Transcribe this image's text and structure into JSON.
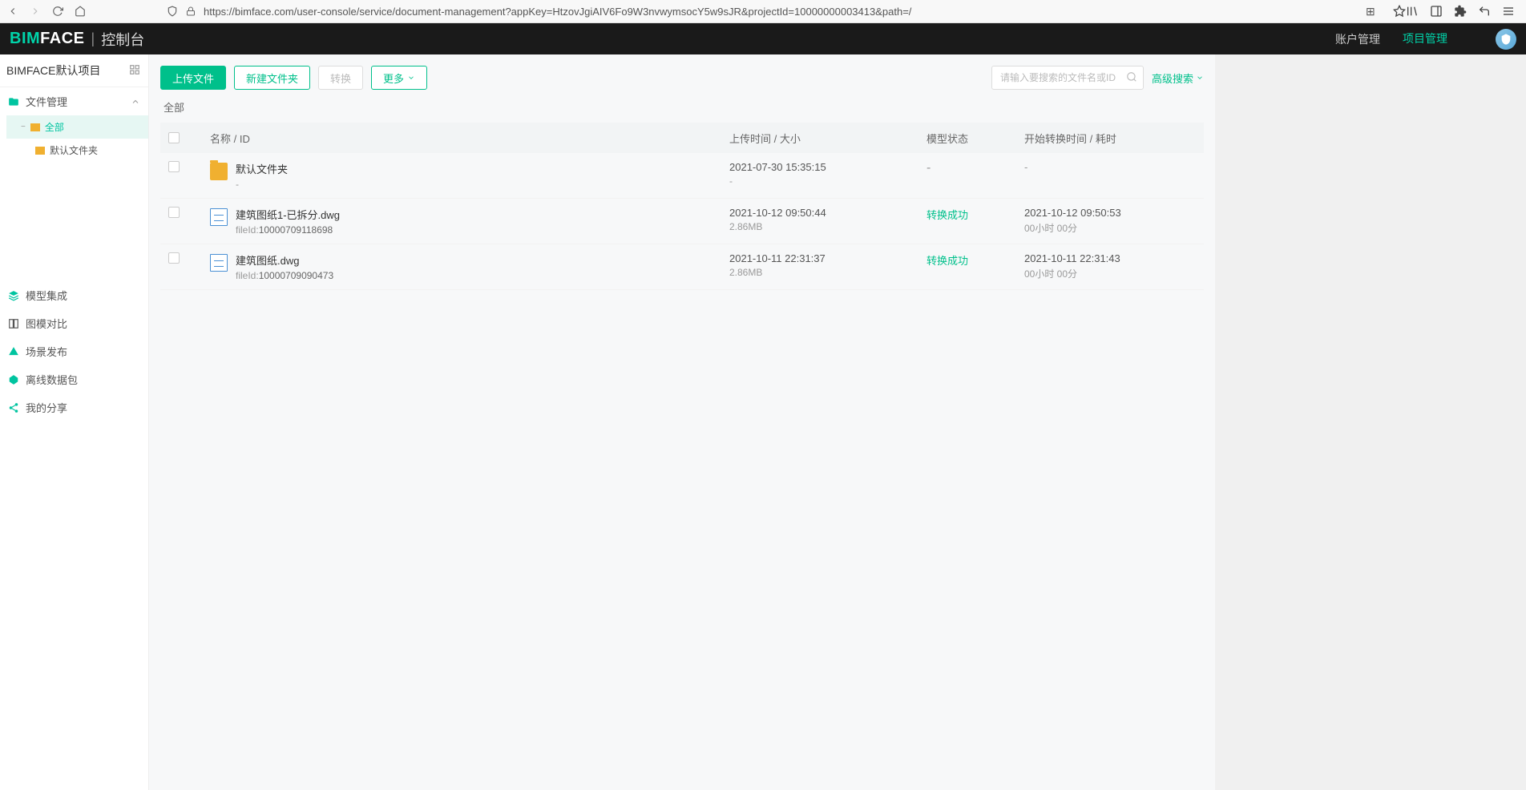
{
  "browser": {
    "url": "https://bimface.com/user-console/service/document-management?appKey=HtzovJgiAIV6Fo9W3nvwymsocY5w9sJR&projectId=10000000003413&path=/"
  },
  "header": {
    "logo_bim": "BIM",
    "logo_face": "FACE",
    "logo_sub": "控制台",
    "nav": {
      "account": "账户管理",
      "project": "项目管理"
    }
  },
  "sidebar": {
    "project_name": "BIMFACE默认项目",
    "file_mgmt": "文件管理",
    "tree": {
      "all": "全部",
      "default_folder": "默认文件夹"
    },
    "items": {
      "model_integration": "模型集成",
      "graph_compare": "图模对比",
      "scene_publish": "场景发布",
      "offline_pack": "离线数据包",
      "my_share": "我的分享"
    }
  },
  "toolbar": {
    "upload": "上传文件",
    "new_folder": "新建文件夹",
    "convert": "转换",
    "more": "更多",
    "search_placeholder": "请输入要搜索的文件名或ID",
    "adv_search": "高级搜索"
  },
  "breadcrumb": "全部",
  "table": {
    "headers": {
      "name": "名称 / ID",
      "upload_time": "上传时间 / 大小",
      "model_status": "模型状态",
      "convert_time": "开始转换时间 / 耗时"
    },
    "rows": [
      {
        "type": "folder",
        "name": "默认文件夹",
        "sub": "-",
        "time": "2021-07-30 15:35:15",
        "size": "-",
        "status": "-",
        "convert_start": "-",
        "convert_dur": ""
      },
      {
        "type": "file",
        "name": "建筑图纸1-已拆分.dwg",
        "fileid_label": "fileId:",
        "fileid": "10000709118698",
        "time": "2021-10-12 09:50:44",
        "size": "2.86MB",
        "status": "转换成功",
        "convert_start": "2021-10-12 09:50:53",
        "convert_dur": "00小时 00分"
      },
      {
        "type": "file",
        "name": "建筑图纸.dwg",
        "fileid_label": "fileId:",
        "fileid": "10000709090473",
        "time": "2021-10-11 22:31:37",
        "size": "2.86MB",
        "status": "转换成功",
        "convert_start": "2021-10-11 22:31:43",
        "convert_dur": "00小时 00分"
      }
    ]
  }
}
